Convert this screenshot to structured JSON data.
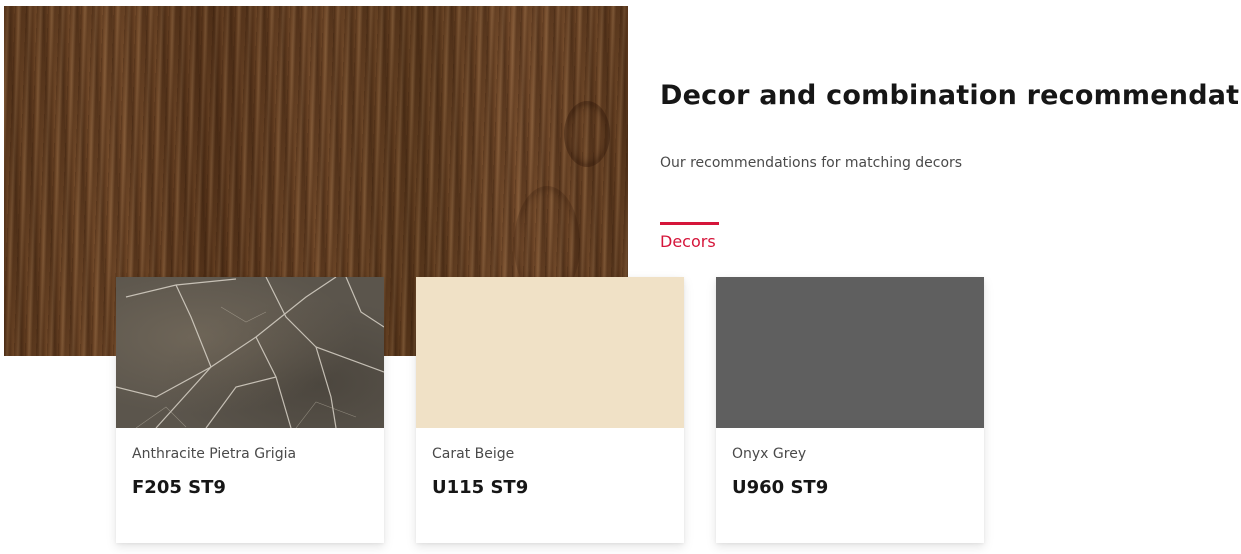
{
  "header": {
    "title": "Decor and combination recommendations",
    "subtitle": "Our recommendations for matching decors"
  },
  "tabs": [
    {
      "label": "Decors",
      "active": true
    }
  ],
  "colors": {
    "accent": "#d5153a",
    "wood": "#654024",
    "marble": "#5b554c",
    "carat_beige": "#f0e1c6",
    "onyx_grey": "#5f5f5f"
  },
  "cards": [
    {
      "name": "Anthracite Pietra Grigia",
      "code": "F205 ST9"
    },
    {
      "name": "Carat Beige",
      "code": "U115 ST9"
    },
    {
      "name": "Onyx Grey",
      "code": "U960 ST9"
    }
  ]
}
